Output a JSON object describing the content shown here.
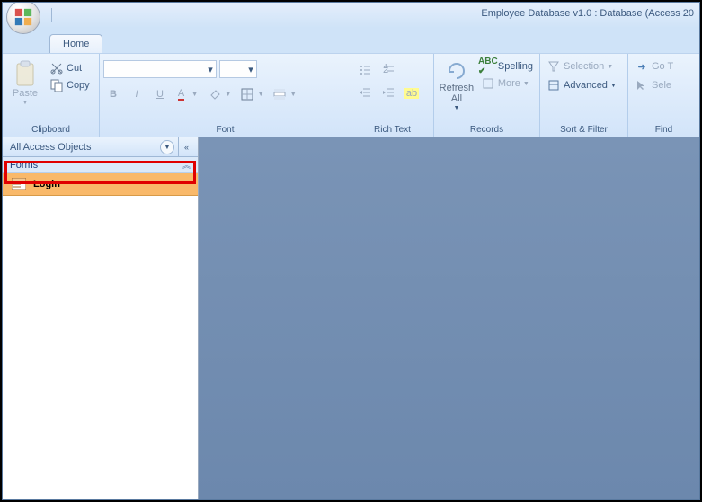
{
  "title": "Employee Database v1.0 : Database (Access 20",
  "tabs": {
    "home": "Home"
  },
  "ribbon": {
    "clipboard": {
      "label": "Clipboard",
      "paste": "Paste",
      "cut": "Cut",
      "copy": "Copy"
    },
    "font": {
      "label": "Font"
    },
    "richtext": {
      "label": "Rich Text"
    },
    "records": {
      "label": "Records",
      "refresh": "Refresh\nAll",
      "spelling": "Spelling",
      "more": "More"
    },
    "sortfilter": {
      "label": "Sort & Filter",
      "selection": "Selection",
      "advanced": "Advanced"
    },
    "find": {
      "label": "Find",
      "goto": "Go T",
      "select": "Sele"
    }
  },
  "nav": {
    "header": "All Access Objects",
    "category": "Forms",
    "items": [
      {
        "label": "Login"
      }
    ]
  }
}
